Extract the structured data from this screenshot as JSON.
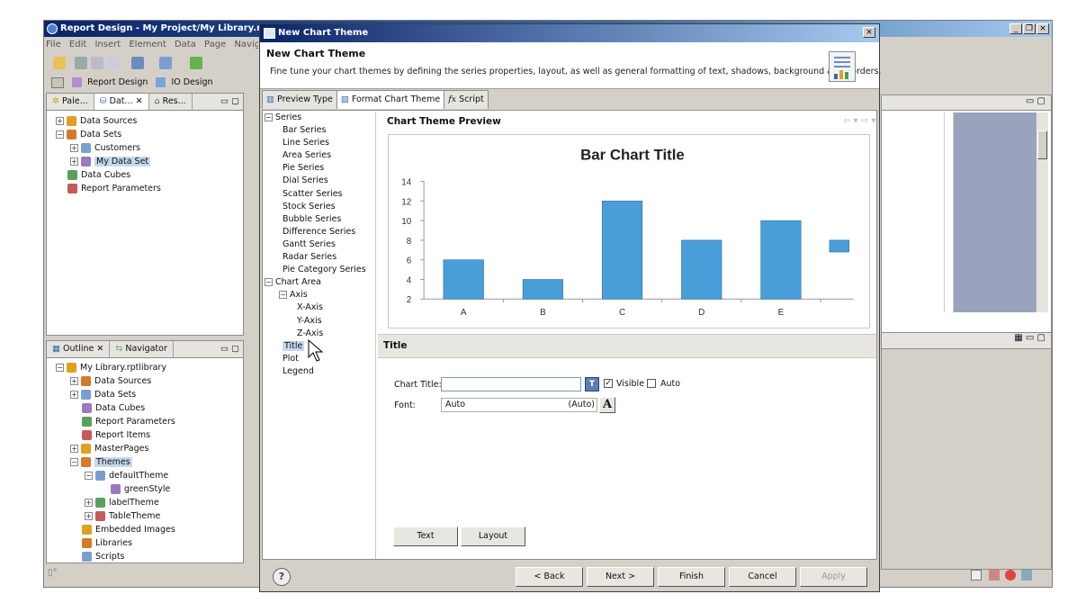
{
  "eclipse": {
    "title": "Report Design - My Project/My Library.rptlib",
    "menu": [
      "File",
      "Edit",
      "Insert",
      "Element",
      "Data",
      "Page",
      "Navigate"
    ],
    "perspectives": [
      "Report Design",
      "IO Design"
    ],
    "data_view": {
      "tabs": [
        "Pale...",
        "Dat...",
        "Res..."
      ],
      "tree": [
        {
          "label": "Data Sources",
          "level": 0,
          "expander": "+"
        },
        {
          "label": "Data Sets",
          "level": 0,
          "expander": "-"
        },
        {
          "label": "Customers",
          "level": 1,
          "expander": "+"
        },
        {
          "label": "My Data Set",
          "level": 1,
          "expander": "+",
          "selected": true
        },
        {
          "label": "Data Cubes",
          "level": 0,
          "expander": ""
        },
        {
          "label": "Report Parameters",
          "level": 0,
          "expander": ""
        }
      ]
    },
    "outline_view": {
      "tabs": [
        "Outline",
        "Navigator"
      ],
      "tree": [
        {
          "label": "My Library.rptlibrary",
          "level": 0,
          "expander": "-"
        },
        {
          "label": "Data Sources",
          "level": 1,
          "expander": "+"
        },
        {
          "label": "Data Sets",
          "level": 1,
          "expander": "+"
        },
        {
          "label": "Data Cubes",
          "level": 1,
          "expander": ""
        },
        {
          "label": "Report Parameters",
          "level": 1,
          "expander": ""
        },
        {
          "label": "Report Items",
          "level": 1,
          "expander": ""
        },
        {
          "label": "MasterPages",
          "level": 1,
          "expander": "+"
        },
        {
          "label": "Themes",
          "level": 1,
          "expander": "-",
          "selected": true
        },
        {
          "label": "defaultTheme",
          "level": 2,
          "expander": "-"
        },
        {
          "label": "greenStyle",
          "level": 3,
          "expander": ""
        },
        {
          "label": "labelTheme",
          "level": 2,
          "expander": "+"
        },
        {
          "label": "TableTheme",
          "level": 2,
          "expander": "+"
        },
        {
          "label": "Embedded Images",
          "level": 1,
          "expander": ""
        },
        {
          "label": "Libraries",
          "level": 1,
          "expander": ""
        },
        {
          "label": "Scripts",
          "level": 1,
          "expander": ""
        }
      ]
    }
  },
  "dialog": {
    "window_title": "New Chart Theme",
    "banner_title": "New Chart Theme",
    "banner_description": "Fine tune your chart themes by defining the series properties, layout, as well as general formatting of text, shadows, background and borders.",
    "tabs": [
      "Preview Type",
      "Format Chart Theme",
      "Script"
    ],
    "active_tab": 1,
    "tree": [
      {
        "label": "Series",
        "level": 0,
        "expander": "-"
      },
      {
        "label": "Bar Series",
        "level": 1
      },
      {
        "label": "Line Series",
        "level": 1
      },
      {
        "label": "Area Series",
        "level": 1
      },
      {
        "label": "Pie Series",
        "level": 1
      },
      {
        "label": "Dial Series",
        "level": 1
      },
      {
        "label": "Scatter Series",
        "level": 1
      },
      {
        "label": "Stock Series",
        "level": 1
      },
      {
        "label": "Bubble Series",
        "level": 1
      },
      {
        "label": "Difference Series",
        "level": 1
      },
      {
        "label": "Gantt Series",
        "level": 1
      },
      {
        "label": "Radar Series",
        "level": 1
      },
      {
        "label": "Pie Category Series",
        "level": 1
      },
      {
        "label": "Chart Area",
        "level": 0,
        "expander": "-"
      },
      {
        "label": "Axis",
        "level": 1,
        "expander": "-"
      },
      {
        "label": "X-Axis",
        "level": 2
      },
      {
        "label": "Y-Axis",
        "level": 2
      },
      {
        "label": "Z-Axis",
        "level": 2
      },
      {
        "label": "Title",
        "level": 1,
        "selected": true
      },
      {
        "label": "Plot",
        "level": 1
      },
      {
        "label": "Legend",
        "level": 1
      }
    ],
    "preview_heading": "Chart Theme Preview",
    "section_title": "Title",
    "form": {
      "chart_title_label": "Chart Title:",
      "chart_title_value": "",
      "visible_label": "Visible",
      "visible_checked": true,
      "auto_label": "Auto",
      "auto_checked": false,
      "font_label": "Font:",
      "font_value": "Auto",
      "font_suffix": "(Auto)"
    },
    "bottom_buttons": {
      "text": "Text",
      "layout": "Layout"
    },
    "footer": {
      "back": "< Back",
      "next": "Next >",
      "finish": "Finish",
      "cancel": "Cancel",
      "apply": "Apply"
    }
  },
  "chart_data": {
    "type": "bar",
    "title": "Bar Chart Title",
    "categories": [
      "A",
      "B",
      "C",
      "D",
      "E"
    ],
    "values": [
      6,
      4,
      12,
      8,
      10
    ],
    "partial_extra_value": 7.5,
    "y_ticks": [
      2,
      4,
      6,
      8,
      10,
      12,
      14
    ],
    "ylim": [
      2,
      14
    ],
    "bar_color": "#4a9ed8"
  },
  "colors": {
    "titlebar": "#0a246a",
    "selection": "#c6d8f0"
  }
}
